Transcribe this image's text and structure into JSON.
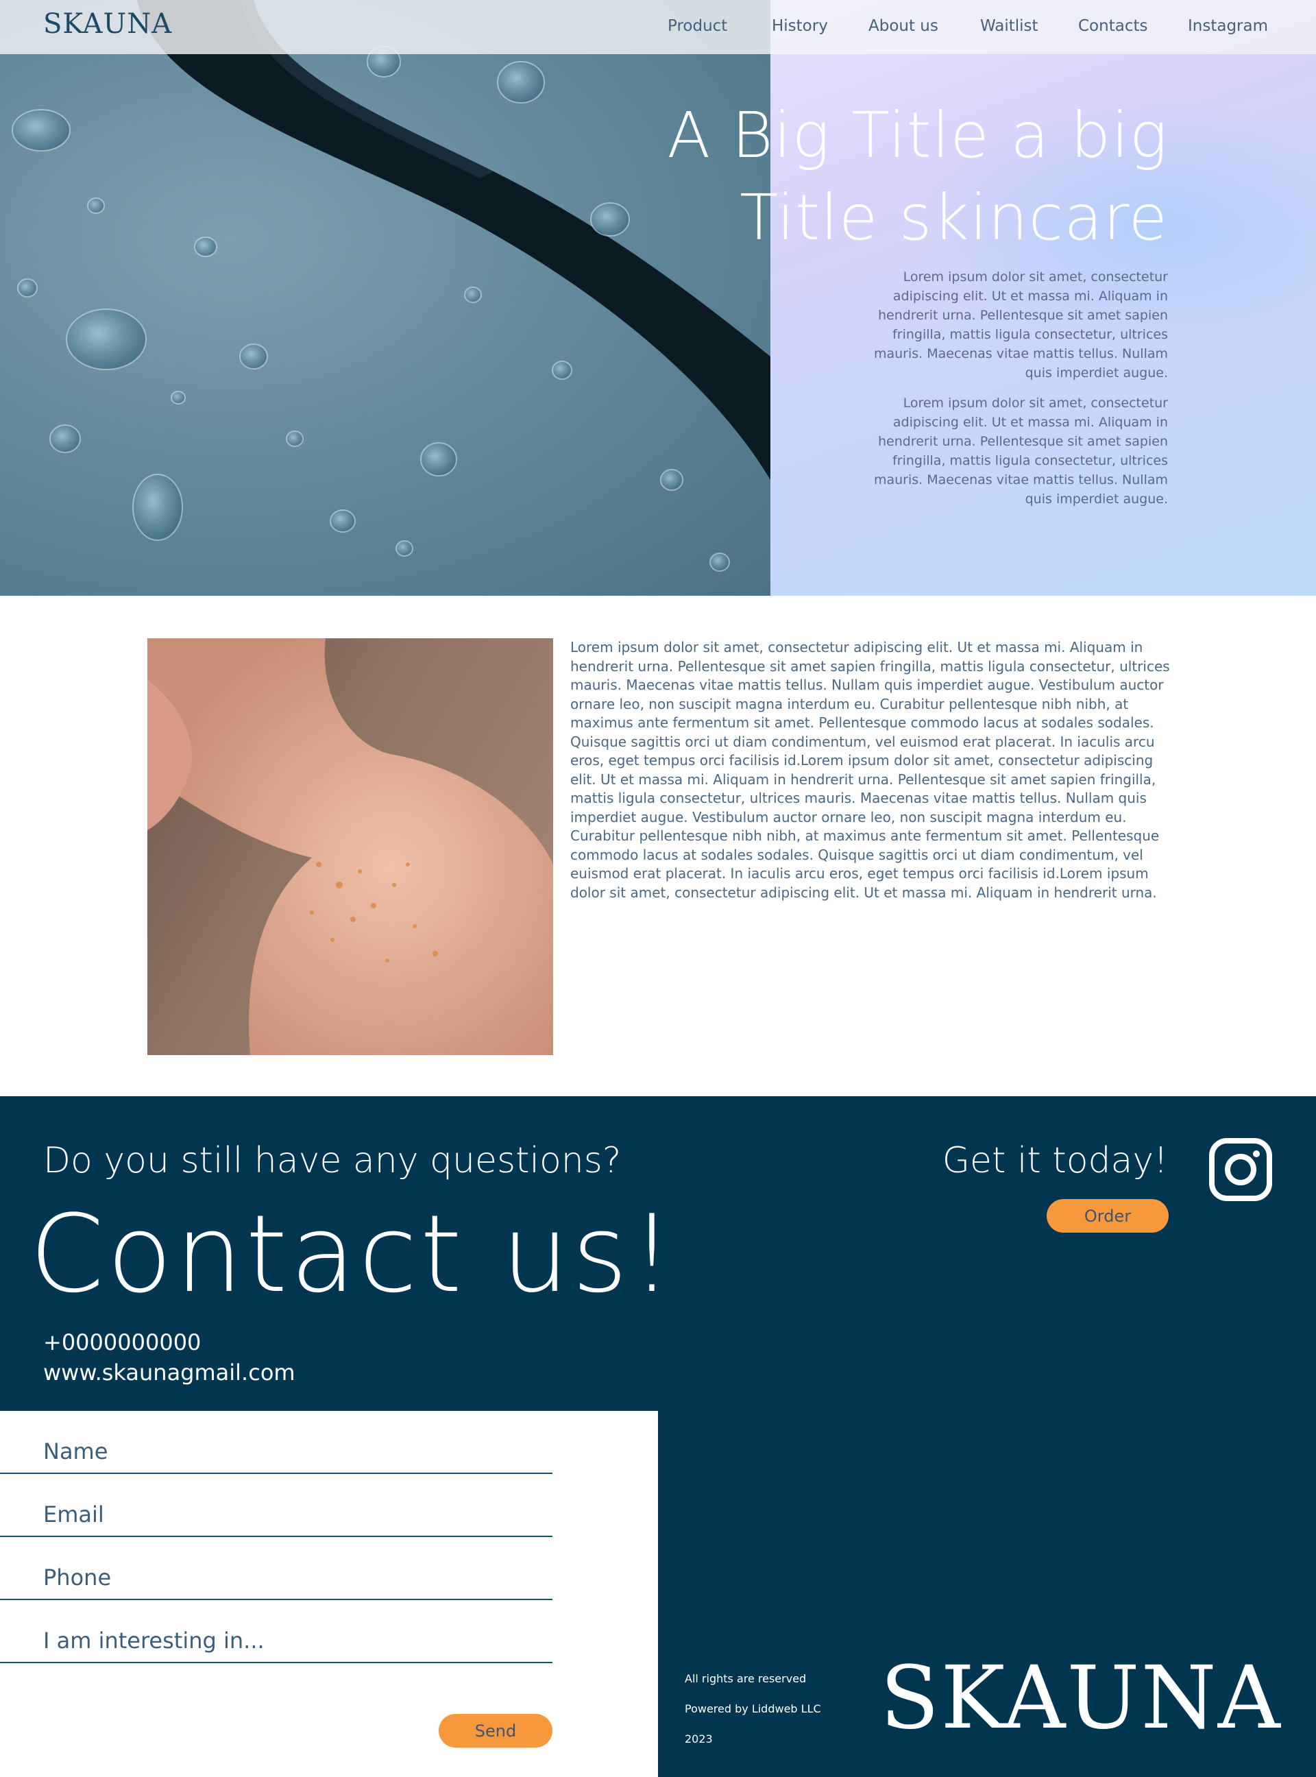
{
  "nav": {
    "logo": "SKAUNA",
    "items": [
      {
        "label": "Product"
      },
      {
        "label": "History"
      },
      {
        "label": "About us"
      },
      {
        "label": "Waitlist"
      },
      {
        "label": "Contacts"
      },
      {
        "label": "Instagram"
      }
    ]
  },
  "hero": {
    "title_line1": "A Big Title a big",
    "title_line2": "Title skincare",
    "paragraphs": [
      "Lorem ipsum dolor sit amet, consectetur adipiscing elit. Ut et massa mi. Aliquam in hendrerit urna. Pellentesque sit amet sapien fringilla, mattis ligula consectetur, ultrices mauris. Maecenas vitae mattis tellus. Nullam quis imperdiet augue.",
      "Lorem ipsum dolor sit amet, consectetur adipiscing elit. Ut et massa mi. Aliquam in hendrerit urna. Pellentesque sit amet sapien fringilla, mattis ligula consectetur, ultrices mauris. Maecenas vitae mattis tellus. Nullam quis imperdiet augue."
    ]
  },
  "about": {
    "text": "Lorem ipsum dolor sit amet, consectetur adipiscing elit. Ut et massa mi. Aliquam in hendrerit urna. Pellentesque sit amet sapien fringilla, mattis ligula consectetur, ultrices mauris. Maecenas vitae mattis tellus. Nullam quis imperdiet augue. Vestibulum auctor ornare leo, non suscipit magna interdum eu. Curabitur pellentesque nibh nibh, at maximus ante fermentum sit amet. Pellentesque commodo lacus at sodales sodales. Quisque sagittis orci ut diam condimentum, vel euismod erat placerat. In iaculis arcu eros, eget tempus orci facilisis id.Lorem ipsum dolor sit amet, consectetur adipiscing elit. Ut et massa mi. Aliquam in hendrerit urna. Pellentesque sit amet sapien fringilla, mattis ligula consectetur, ultrices mauris. Maecenas vitae mattis tellus. Nullam quis imperdiet augue. Vestibulum auctor ornare leo, non suscipit magna interdum eu. Curabitur pellentesque nibh nibh, at maximus ante fermentum sit amet. Pellentesque commodo lacus at sodales sodales. Quisque sagittis orci ut diam condimentum, vel euismod erat placerat. In iaculis arcu eros, eget tempus orci facilisis id.Lorem ipsum dolor sit amet, consectetur adipiscing elit. Ut et massa mi. Aliquam in hendrerit urna."
  },
  "contact": {
    "question": "Do you still have any questions?",
    "headline": "Contact us!",
    "phone": "+0000000000",
    "website": "www.skaunagmail.com",
    "cta_heading": "Get it today!",
    "order_label": "Order",
    "instagram_icon": "instagram-icon"
  },
  "form": {
    "name_placeholder": "Name",
    "email_placeholder": "Email",
    "phone_placeholder": "Phone",
    "interest_placeholder": "I am interesting in...",
    "send_label": "Send"
  },
  "footer": {
    "rights": "All rights are reserved",
    "powered": "Powered by Liddweb LLC",
    "year": "2023",
    "logo": "SKAUNA"
  },
  "colors": {
    "navy": "#023650",
    "orange": "#f8983d",
    "lavender": "#d8d3fb"
  }
}
